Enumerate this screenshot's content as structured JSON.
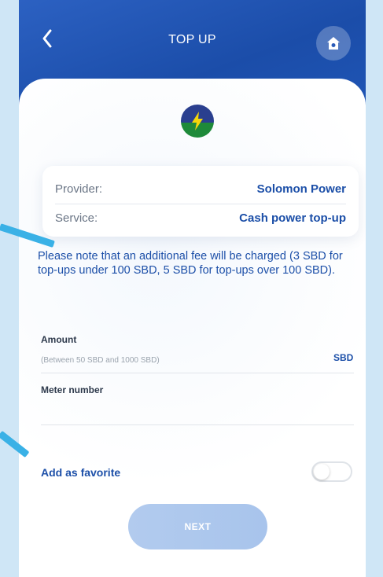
{
  "header": {
    "title": "TOP UP",
    "back_icon": "chevron-left-icon",
    "home_icon": "home-icon"
  },
  "provider_logo_icon": "lightning-bolt-icon",
  "info": {
    "provider_label": "Provider:",
    "provider_value": "Solomon Power",
    "service_label": "Service:",
    "service_value": "Cash power top-up"
  },
  "note": "Please note that an additional fee will be charged (3 SBD for top-ups under 100 SBD, 5 SBD for top-ups over 100 SBD).",
  "form": {
    "amount_label": "Amount",
    "amount_placeholder": "(Between 50 SBD and 1000 SBD)",
    "amount_currency": "SBD",
    "meter_label": "Meter number",
    "meter_value": "",
    "favorite_label": "Add as favorite",
    "favorite_on": false
  },
  "next_label": "NEXT",
  "colors": {
    "header_blue": "#1f55b5",
    "accent": "#1c4fa8",
    "page_background": "#cfe6f6",
    "pointer": "#3ab1e6",
    "next_button": "#b2cbee"
  }
}
